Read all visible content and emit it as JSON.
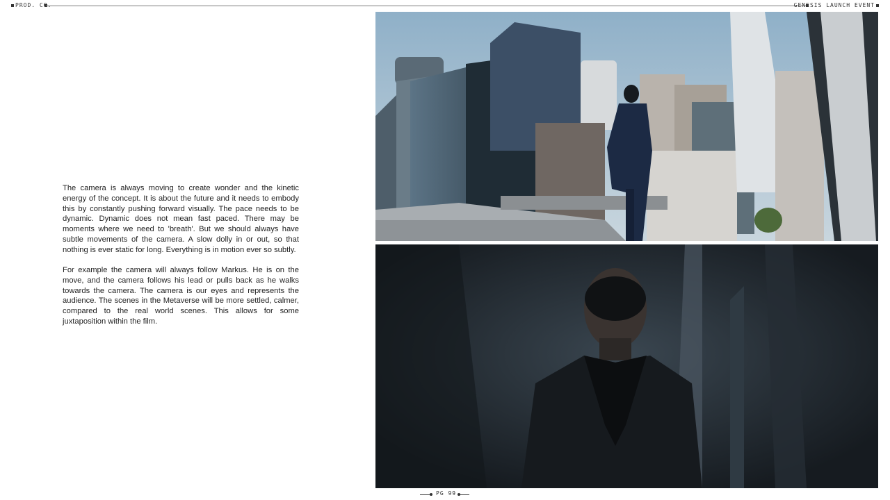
{
  "header": {
    "left_label": "PROD. CO.",
    "right_label": "GENESIS LAUNCH EVENT"
  },
  "body": {
    "paragraph_1": "The camera is always moving to create wonder and the kinetic energy of the concept. It is about the future and it needs to embody this by constantly pushing forward visually. The pace needs to be dynamic. Dynamic does not mean fast paced. There may be moments where we need to 'breath'. But we should always have subtle movements of the camera. A slow dolly in or out, so that nothing is ever static for long. Everything is in motion ever so subtly.",
    "paragraph_2": "For example the camera will always follow Markus. He is on the move, and the camera follows his lead or pulls back as he walks towards the camera. The camera is our eyes and represents the audience. The scenes in the Metaverse will be more settled, calmer, compared to the real world scenes. This allows for some juxtaposition within the film."
  },
  "footer": {
    "page_label": "PG 99"
  },
  "colors": {
    "sky": "#a9bfcf",
    "building_dark": "#2c3a44",
    "suit_navy": "#1c2a44",
    "interior_dark": "#1c2228"
  }
}
